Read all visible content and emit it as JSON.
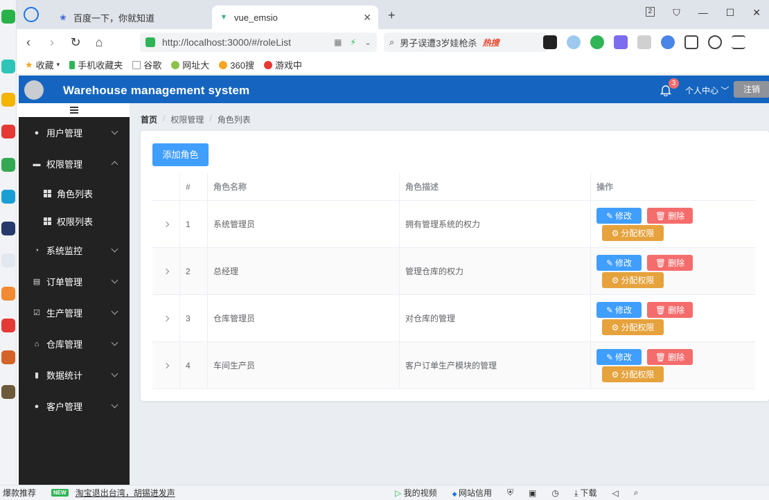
{
  "browser": {
    "tabs": [
      {
        "label": "百度一下，你就知道"
      },
      {
        "label": "vue_emsio"
      }
    ],
    "url": "http://localhost:3000/#/roleList",
    "search": {
      "text": "男子误遭3岁娃枪杀",
      "hot_label": "热搜"
    },
    "window_controls": {
      "count": "2"
    },
    "bookmarks": [
      "收藏",
      "手机收藏夹",
      "谷歌",
      "网址大",
      "360搜",
      "游戏中"
    ]
  },
  "app": {
    "title": "Warehouse management system",
    "notification_count": "3",
    "user_center": "个人中心 ﹀",
    "logout": "注销"
  },
  "sidebar": {
    "items": [
      {
        "label": "用户管理"
      },
      {
        "label": "权限管理"
      },
      {
        "label": "系统监控"
      },
      {
        "label": "订单管理"
      },
      {
        "label": "生产管理"
      },
      {
        "label": "仓库管理"
      },
      {
        "label": "数据统计"
      },
      {
        "label": "客户管理"
      }
    ],
    "subitems": [
      {
        "label": "角色列表"
      },
      {
        "label": "权限列表"
      }
    ]
  },
  "breadcrumb": [
    "首页",
    "权限管理",
    "角色列表"
  ],
  "main": {
    "add_button": "添加角色",
    "table": {
      "headers": [
        "#",
        "角色名称",
        "角色描述",
        "操作"
      ],
      "rows": [
        {
          "index": "1",
          "name": "系统管理员",
          "desc": "拥有管理系统的权力"
        },
        {
          "index": "2",
          "name": "总经理",
          "desc": "管理仓库的权力"
        },
        {
          "index": "3",
          "name": "仓库管理员",
          "desc": "对仓库的管理"
        },
        {
          "index": "4",
          "name": "车间生产员",
          "desc": "客户订单生产模块的管理"
        }
      ],
      "actions": {
        "edit": "修改",
        "delete": "删除",
        "assign": "分配权限"
      }
    }
  },
  "statusbar": {
    "left": "爆款推荐",
    "new_tag": "NEW",
    "news": "淘宝退出台湾，胡锡进发声",
    "video": "我的视频",
    "credit": "网站信用",
    "download": "下载"
  },
  "colors": {
    "header": "#1565c0",
    "sidebar": "#222222",
    "primary": "#409eff",
    "danger": "#f56c6c",
    "warning": "#e6a23c"
  }
}
